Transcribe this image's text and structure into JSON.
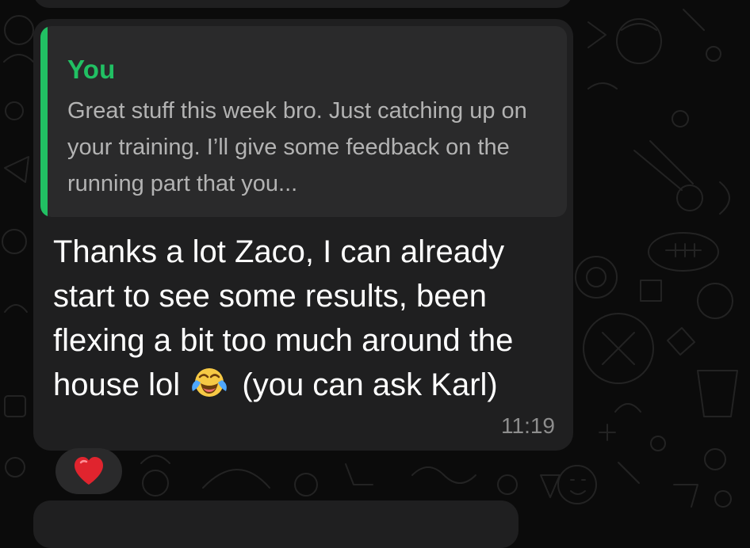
{
  "chat": {
    "message": {
      "quote": {
        "author": "You",
        "text": "Great stuff this week bro. Just catching up on your training. I’ll give some feedback on the running part that you..."
      },
      "text_before_emoji": "Thanks a lot Zaco, I can already start to see some results, been flexing a bit too much around the house lol",
      "emoji": "face-with-tears-of-joy",
      "text_after_emoji": "(you can ask Karl)",
      "time": "11:19",
      "reaction": "red-heart"
    }
  },
  "colors": {
    "background": "#0b0b0b",
    "bubble": "#1f1f20",
    "quote_background": "#2a2a2b",
    "quote_accent": "#21c063",
    "quote_text": "#b3b3b3",
    "message_text": "#ffffff",
    "timestamp": "#8d8d8d",
    "heart": "#e0242e"
  }
}
